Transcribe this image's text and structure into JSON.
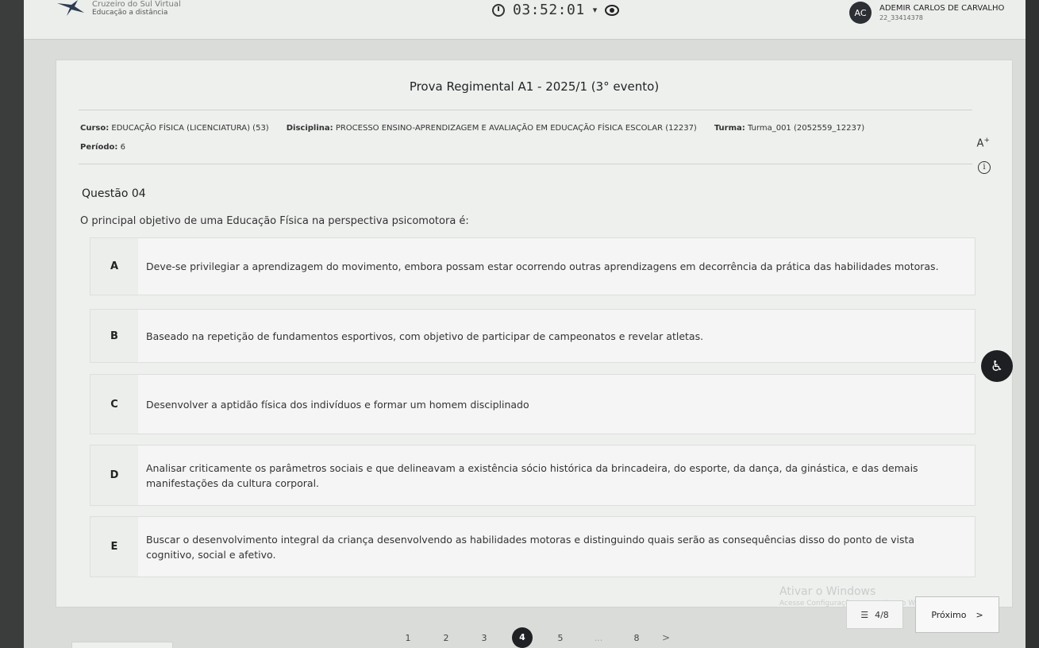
{
  "header": {
    "brand": "Cruzeiro do Sul Virtual",
    "brand_sub": "Educação a distância",
    "timer": "03:52:01",
    "user_initials": "AC",
    "user_name": "ADEMIR CARLOS DE CARVALHO",
    "user_id": "22_33414378"
  },
  "exam": {
    "title": "Prova Regimental A1 - 2025/1 (3° evento)",
    "course_label": "Curso:",
    "course_value": "EDUCAÇÃO FÍSICA (LICENCIATURA) (53)",
    "discipline_label": "Disciplina:",
    "discipline_value": "PROCESSO ENSINO-APRENDIZAGEM E AVALIAÇÃO EM EDUCAÇÃO FÍSICA ESCOLAR (12237)",
    "class_label": "Turma:",
    "class_value": "Turma_001 (2052559_12237)",
    "period_label": "Período:",
    "period_value": "6",
    "font_size_button": "A"
  },
  "question": {
    "number": "Questão 04",
    "text": "O principal objetivo de uma Educação Física na perspectiva psicomotora é:",
    "options": [
      {
        "letter": "A",
        "text": "Deve-se privilegiar a aprendizagem do movimento, embora possam estar ocorrendo outras aprendizagens em decorrência da prática das habilidades motoras."
      },
      {
        "letter": "B",
        "text": "Baseado na repetição de fundamentos esportivos, com objetivo de participar de campeonatos e revelar atletas."
      },
      {
        "letter": "C",
        "text": "Desenvolver a aptidão física dos indivíduos e formar um homem disciplinado"
      },
      {
        "letter": "D",
        "text": "Analisar criticamente os parâmetros sociais e que delineavam a existência sócio histórica da brincadeira, do esporte, da dança, da ginástica, e das demais manifestações da cultura corporal."
      },
      {
        "letter": "E",
        "text": "Buscar o desenvolvimento integral da criança desenvolvendo as habilidades motoras e distinguindo quais serão as consequências disso do ponto de vista cognitivo, social e afetivo."
      }
    ]
  },
  "watermark": {
    "title": "Ativar o Windows",
    "subtitle": "Acesse Configurações para ativar o Windows."
  },
  "pagination": {
    "pages": [
      "1",
      "2",
      "3",
      "4",
      "5",
      "...",
      "8"
    ],
    "active": "4",
    "next_arrow": ">"
  },
  "footer": {
    "counter": "4/8",
    "next_label": "Próximo",
    "next_arrow": ">"
  }
}
